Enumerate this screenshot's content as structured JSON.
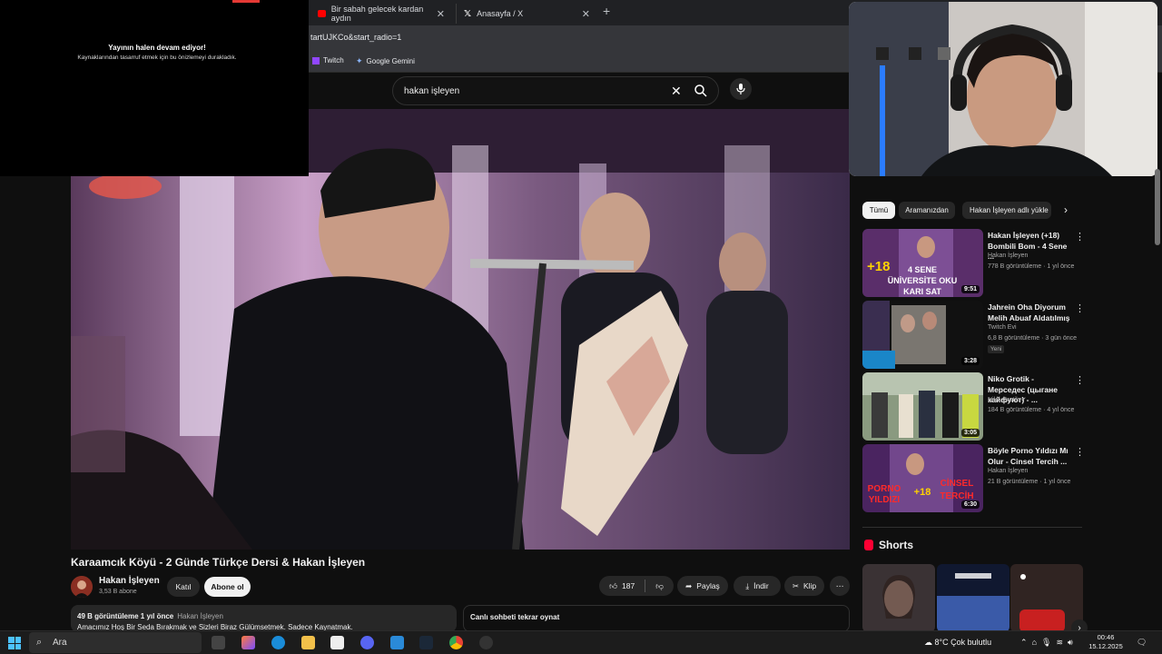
{
  "browser": {
    "tabs": [
      {
        "label": "Bir sabah gelecek kardan aydın"
      },
      {
        "label": "Anasayfa / X"
      }
    ],
    "url": "tartUJKCo&start_radio=1",
    "bookmarks": [
      {
        "label": "Twitch"
      },
      {
        "label": "Google Gemini"
      }
    ]
  },
  "overlay": {
    "title": "Yayının halen devam ediyor!",
    "subtitle": "Kaynaklarından tasarruf etmek için bu önizlemeyi durakladık."
  },
  "search": {
    "value": "hakan işleyen"
  },
  "video": {
    "title": "Karaamcık Köyü - 2 Günde Türkçe Dersi & Hakan İşleyen",
    "channel": "Hakan İşleyen",
    "subscribers": "3,53 B abone",
    "join_label": "Katıl",
    "subscribe_label": "Abone ol",
    "likes": "187",
    "share_label": "Paylaş",
    "download_label": "İndir",
    "clip_label": "Klip",
    "views_time": "49 B görüntüleme  1 yıl önce",
    "desc_tag": "Hakan İşleyen",
    "description": "Amacımız Hoş Bir Seda Bırakmak ve Sizleri Biraz Gülümsetmek. Sadece Kaynatmak.",
    "chat_replay": "Canlı sohbeti tekrar oynat"
  },
  "chips": [
    {
      "label": "Tümü"
    },
    {
      "label": "Aramanızdan"
    },
    {
      "label": "Hakan İşleyen adlı yükle"
    }
  ],
  "related": [
    {
      "title": "Hakan İşleyen (+18) Bombili Bom - 4 Sene ...",
      "channel": "Hakan İşleyen",
      "meta": "778 B görüntüleme · 1 yıl önce",
      "duration": "9:51",
      "badge": ""
    },
    {
      "title": "Jahrein Oha Diyorum Melih Abuaf Aldatılmış",
      "channel": "Twitch Evi",
      "meta": "6,8 B görüntüleme · 3 gün önce",
      "duration": "3:28",
      "badge": "Yeni"
    },
    {
      "title": "Niko Grotik - Мерседес (цыгане кайфуют) - ...",
      "channel": "Niko Grotik",
      "meta": "184 B görüntüleme · 4 yıl önce",
      "duration": "3:05",
      "badge": ""
    },
    {
      "title": "Böyle Porno Yıldızı Mı Olur - Cinsel Tercih ...",
      "channel": "Hakan İşleyen",
      "meta": "21 B görüntüleme · 1 yıl önce",
      "duration": "6:30",
      "badge": ""
    }
  ],
  "thumb_text": {
    "r1_badge": "+18",
    "r1_line1": "4 SENE",
    "r1_line2": "ÜNİVERSİTE OKU",
    "r1_line3": "KARI SAT",
    "r4_left": "PORNO",
    "r4_left2": "YILDIZI",
    "r4_badge": "+18",
    "r4_right": "CİNSEL",
    "r4_right2": "TERCİH"
  },
  "shorts": {
    "heading": "Shorts"
  },
  "taskbar": {
    "search": "Ara",
    "weather": "8°C  Çok bulutlu",
    "time": "00:46",
    "date": "15.12.2025"
  },
  "colors": {
    "background": "#0f0f0f",
    "accent_red": "#ff0000",
    "chip_active": "#f1f1f1"
  }
}
